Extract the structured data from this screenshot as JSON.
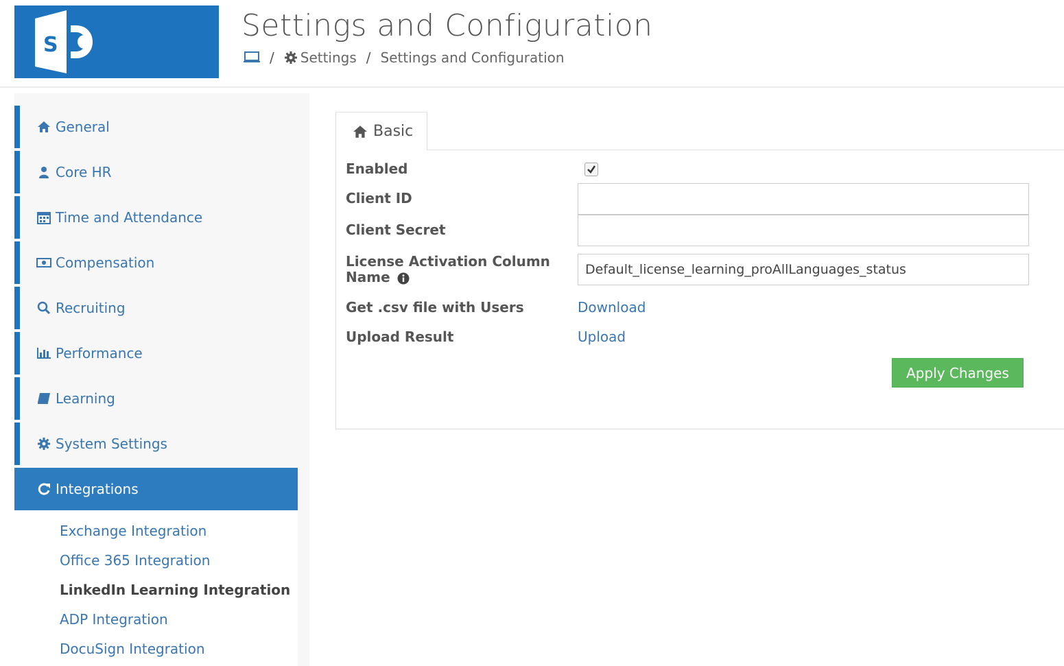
{
  "header": {
    "logo_letter": "S",
    "title": "Settings and Configuration",
    "breadcrumb": {
      "home_icon": "computer-icon",
      "separator": "/",
      "settings_label": "Settings",
      "current_label": "Settings and Configuration"
    }
  },
  "sidebar": {
    "items": [
      {
        "label": "General",
        "icon": "home-icon"
      },
      {
        "label": "Core HR",
        "icon": "user-icon"
      },
      {
        "label": "Time and Attendance",
        "icon": "calendar-icon"
      },
      {
        "label": "Compensation",
        "icon": "money-icon"
      },
      {
        "label": "Recruiting",
        "icon": "search-icon"
      },
      {
        "label": "Performance",
        "icon": "bar-chart-icon"
      },
      {
        "label": "Learning",
        "icon": "book-icon"
      },
      {
        "label": "System Settings",
        "icon": "gear-icon"
      },
      {
        "label": "Integrations",
        "icon": "refresh-icon",
        "active": true
      }
    ],
    "sub_items": [
      {
        "label": "Exchange Integration"
      },
      {
        "label": "Office 365 Integration"
      },
      {
        "label": "LinkedIn Learning Integration",
        "current": true
      },
      {
        "label": "ADP Integration"
      },
      {
        "label": "DocuSign Integration"
      }
    ]
  },
  "tab": {
    "label": "Basic",
    "icon": "home-icon"
  },
  "form": {
    "enabled_label": "Enabled",
    "enabled_checked": true,
    "client_id_label": "Client ID",
    "client_id_value": "",
    "client_secret_label": "Client Secret",
    "client_secret_value": "",
    "license_label": "License Activation Column Name",
    "license_value": "Default_license_learning_proAllLanguages_status",
    "csv_label": "Get .csv file with Users",
    "download_link": "Download",
    "upload_label": "Upload Result",
    "upload_link": "Upload",
    "apply_button": "Apply Changes"
  },
  "colors": {
    "brand_blue": "#1e73be",
    "active_nav": "#2e7cc0",
    "link": "#3a76b0",
    "apply_green": "#5cb85c"
  }
}
